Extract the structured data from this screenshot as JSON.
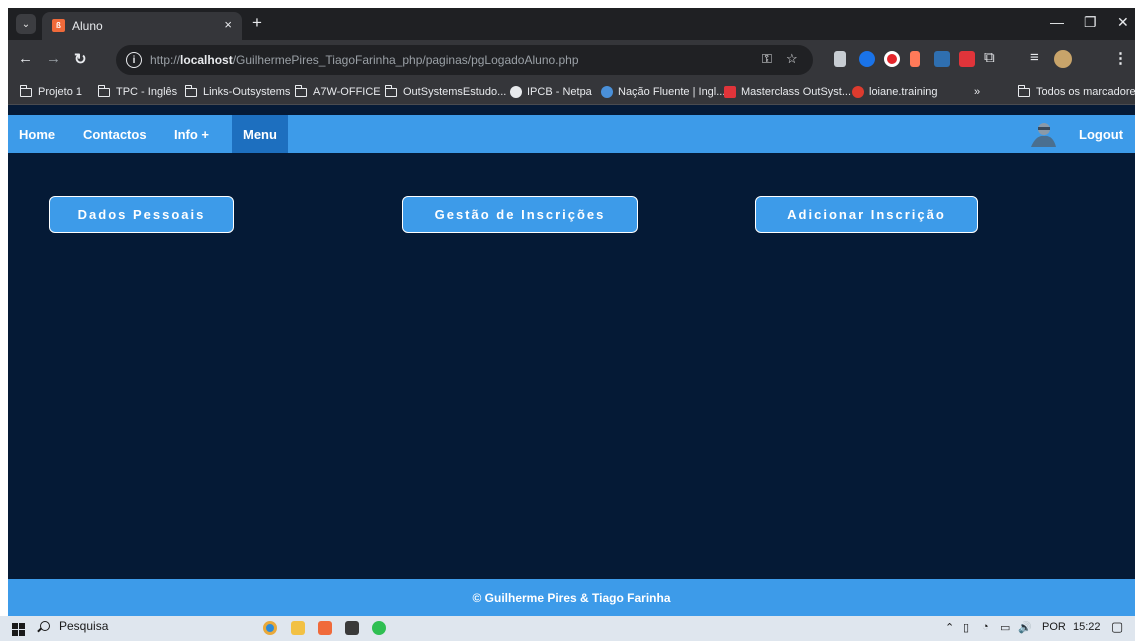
{
  "browser": {
    "tab_title": "Aluno",
    "tab_close": "×",
    "new_tab": "+",
    "window_controls": {
      "minimize": "—",
      "restore": "❐",
      "close": "✕"
    },
    "url_prefix": "http://",
    "url_host": "localhost",
    "url_path": "/GuilhermePires_TiagoFarinha_php/paginas/pgLogadoAluno.php",
    "bookmarks": [
      {
        "label": "Projeto 1",
        "icon": "folder-icon"
      },
      {
        "label": "TPC - Inglês",
        "icon": "folder-icon"
      },
      {
        "label": "Links-Outsystems",
        "icon": "folder-icon"
      },
      {
        "label": "A7W-OFFICE",
        "icon": "folder-icon"
      },
      {
        "label": "OutSystemsEstudo...",
        "icon": "folder-icon"
      },
      {
        "label": "IPCB - Netpa",
        "icon": "globe-icon"
      },
      {
        "label": "Nação Fluente | Ingl...",
        "icon": "site-icon"
      },
      {
        "label": "Masterclass OutSyst...",
        "icon": "site-icon"
      },
      {
        "label": "loiane.training",
        "icon": "site-icon"
      }
    ],
    "bookmarks_overflow": "»",
    "all_bookmarks": "Todos os marcadores"
  },
  "navbar": {
    "links": [
      "Home",
      "Contactos",
      "Info +",
      "Menu"
    ],
    "active": "Menu",
    "logout": "Logout"
  },
  "actions": [
    "Dados Pessoais",
    "Gestão de Inscrições",
    "Adicionar Inscrição"
  ],
  "footer": "© Guilherme Pires & Tiago Farinha",
  "taskbar": {
    "search_label": "Pesquisa",
    "tray_language": "POR",
    "clock": "15:22"
  },
  "colors": {
    "page_bg": "#051a36",
    "accent": "#3d9be9",
    "active_nav": "#1d6fbf"
  }
}
